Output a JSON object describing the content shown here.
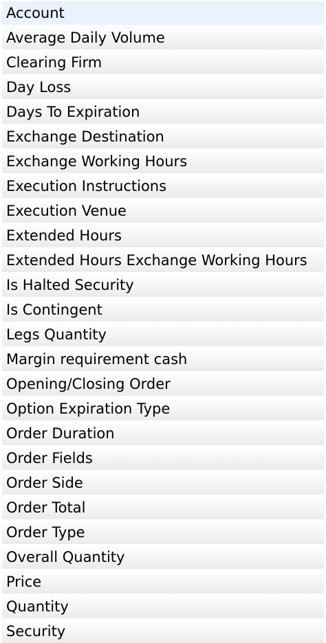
{
  "list": {
    "selected_index": 0,
    "items": [
      "Account",
      "Average Daily Volume",
      "Clearing Firm",
      "Day Loss",
      "Days To Expiration",
      "Exchange Destination",
      "Exchange Working Hours",
      "Execution Instructions",
      "Execution Venue",
      "Extended Hours",
      "Extended Hours Exchange Working Hours",
      "Is Halted Security",
      "Is Contingent",
      "Legs Quantity",
      "Margin requirement cash",
      "Opening/Closing Order",
      "Option Expiration Type",
      "Order Duration",
      "Order Fields",
      "Order Side",
      "Order Total",
      "Order Type",
      "Overall Quantity",
      "Price",
      "Quantity",
      "Security"
    ]
  },
  "colors": {
    "selected_row": "#e9f2fe",
    "row_top": "#ffffff",
    "row_bottom": "#ebebeb",
    "text": "#000000"
  }
}
